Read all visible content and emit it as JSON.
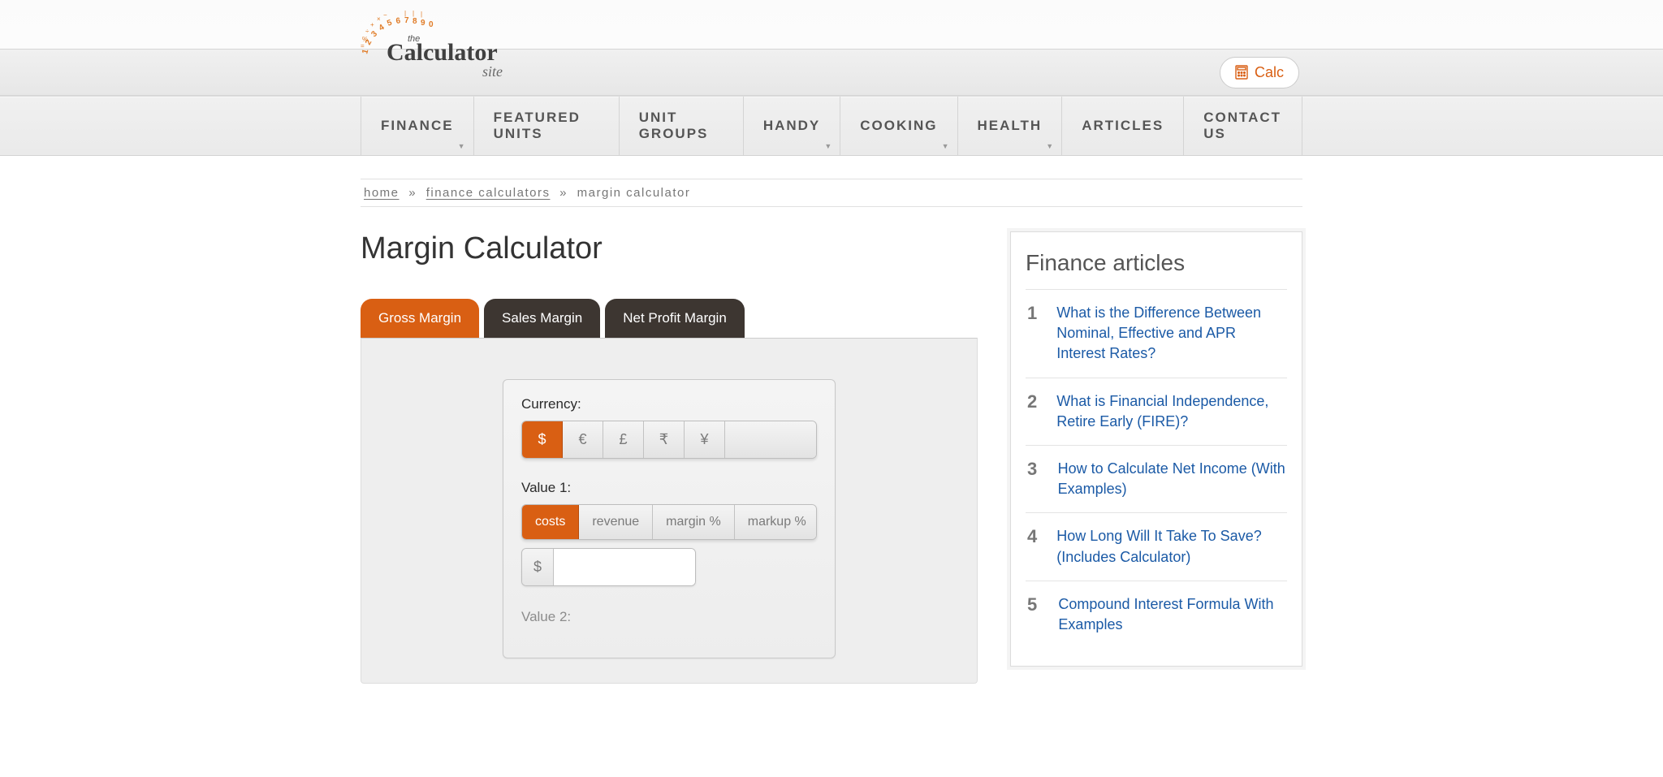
{
  "header": {
    "calc_btn": "Calc"
  },
  "nav": {
    "items": [
      "FINANCE",
      "FEATURED UNITS",
      "UNIT GROUPS",
      "HANDY",
      "COOKING",
      "HEALTH",
      "ARTICLES",
      "CONTACT US"
    ],
    "has_dropdown": [
      true,
      false,
      false,
      true,
      true,
      true,
      false,
      false
    ]
  },
  "breadcrumb": {
    "home": "home",
    "finance": "finance calculators",
    "current": "margin calculator"
  },
  "page": {
    "title": "Margin Calculator"
  },
  "tabs": {
    "items": [
      "Gross Margin",
      "Sales Margin",
      "Net Profit Margin"
    ],
    "active": 0
  },
  "form": {
    "currency_label": "Currency:",
    "currencies": [
      "$",
      "€",
      "£",
      "₹",
      "¥"
    ],
    "currency_active": 0,
    "value1_label": "Value 1:",
    "value1_options": [
      "costs",
      "revenue",
      "margin %",
      "markup %"
    ],
    "value1_active": 0,
    "value1_prefix": "$",
    "value1_value": "",
    "value2_label_partial": "Value 2:"
  },
  "sidebar": {
    "title": "Finance articles",
    "articles": [
      {
        "n": "1",
        "t": "What is the Difference Between Nominal, Effective and APR Interest Rates?"
      },
      {
        "n": "2",
        "t": "What is Financial Independence, Retire Early (FIRE)?"
      },
      {
        "n": "3",
        "t": "How to Calculate Net Income (With Examples)"
      },
      {
        "n": "4",
        "t": "How Long Will It Take To Save? (Includes Calculator)"
      },
      {
        "n": "5",
        "t": "Compound Interest Formula With Examples"
      }
    ]
  }
}
